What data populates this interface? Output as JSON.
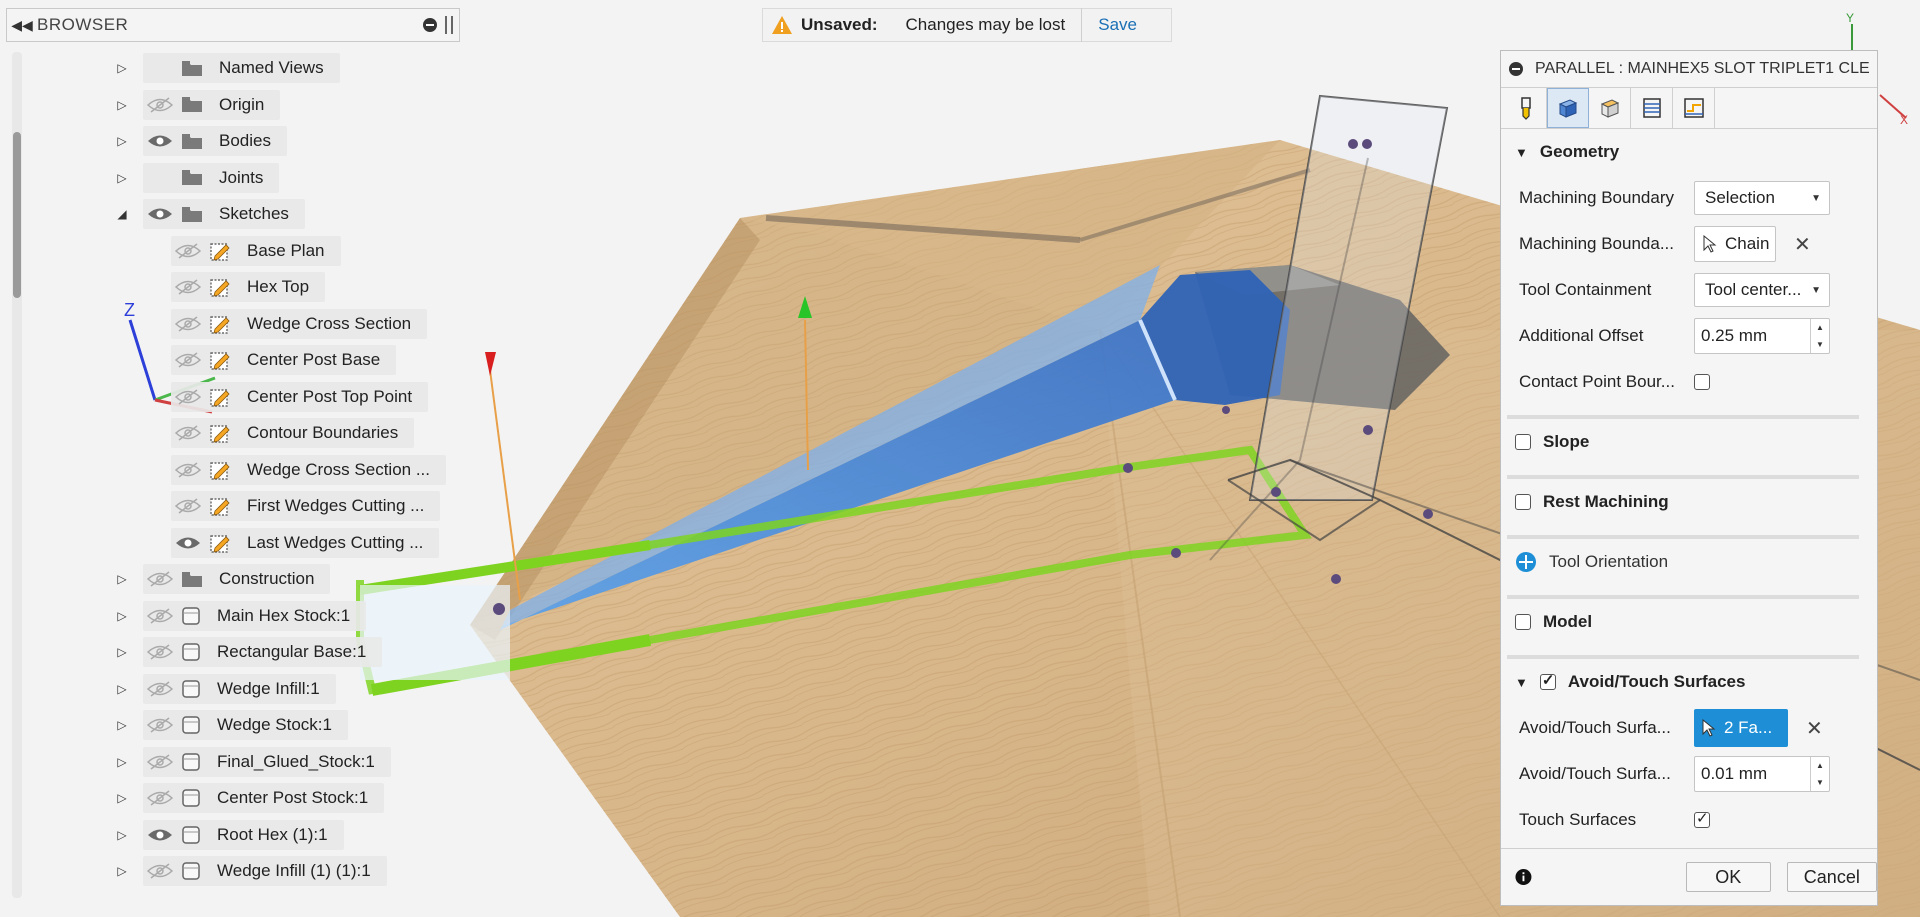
{
  "browser": {
    "title": "BROWSER",
    "items": [
      {
        "label": "Named Views",
        "level": 0,
        "expand": "collapsed",
        "eye": "none",
        "icon": "folder"
      },
      {
        "label": "Origin",
        "level": 0,
        "expand": "collapsed",
        "eye": "hidden",
        "icon": "folder"
      },
      {
        "label": "Bodies",
        "level": 0,
        "expand": "collapsed",
        "eye": "visible",
        "icon": "folder"
      },
      {
        "label": "Joints",
        "level": 0,
        "expand": "collapsed",
        "eye": "none",
        "icon": "folder"
      },
      {
        "label": "Sketches",
        "level": 0,
        "expand": "expanded",
        "eye": "visible",
        "icon": "folder"
      },
      {
        "label": "Base Plan",
        "level": 1,
        "expand": "none",
        "eye": "hidden",
        "icon": "sketch"
      },
      {
        "label": "Hex Top",
        "level": 1,
        "expand": "none",
        "eye": "hidden",
        "icon": "sketch"
      },
      {
        "label": "Wedge Cross Section",
        "level": 1,
        "expand": "none",
        "eye": "hidden",
        "icon": "sketch"
      },
      {
        "label": "Center Post Base",
        "level": 1,
        "expand": "none",
        "eye": "hidden",
        "icon": "sketch"
      },
      {
        "label": "Center Post Top Point",
        "level": 1,
        "expand": "none",
        "eye": "hidden",
        "icon": "sketch"
      },
      {
        "label": "Contour Boundaries",
        "level": 1,
        "expand": "none",
        "eye": "hidden",
        "icon": "sketch"
      },
      {
        "label": "Wedge Cross Section ...",
        "level": 1,
        "expand": "none",
        "eye": "hidden",
        "icon": "sketch"
      },
      {
        "label": "First Wedges Cutting ...",
        "level": 1,
        "expand": "none",
        "eye": "hidden",
        "icon": "sketch"
      },
      {
        "label": "Last Wedges Cutting ...",
        "level": 1,
        "expand": "none",
        "eye": "visible",
        "icon": "sketch"
      },
      {
        "label": "Construction",
        "level": 0,
        "expand": "collapsed",
        "eye": "hidden",
        "icon": "folder"
      },
      {
        "label": "Main Hex Stock:1",
        "level": 0,
        "expand": "collapsed",
        "eye": "hidden",
        "icon": "component"
      },
      {
        "label": "Rectangular Base:1",
        "level": 0,
        "expand": "collapsed",
        "eye": "hidden",
        "icon": "component"
      },
      {
        "label": "Wedge Infill:1",
        "level": 0,
        "expand": "collapsed",
        "eye": "hidden",
        "icon": "component"
      },
      {
        "label": "Wedge Stock:1",
        "level": 0,
        "expand": "collapsed",
        "eye": "hidden",
        "icon": "component"
      },
      {
        "label": "Final_Glued_Stock:1",
        "level": 0,
        "expand": "collapsed",
        "eye": "hidden",
        "icon": "component"
      },
      {
        "label": "Center Post Stock:1",
        "level": 0,
        "expand": "collapsed",
        "eye": "hidden",
        "icon": "component"
      },
      {
        "label": "Root Hex (1):1",
        "level": 0,
        "expand": "collapsed",
        "eye": "visible",
        "icon": "component"
      },
      {
        "label": "Wedge Infill (1) (1):1",
        "level": 0,
        "expand": "collapsed",
        "eye": "hidden",
        "icon": "component"
      }
    ]
  },
  "unsaved": {
    "status": "Unsaved:",
    "message": "Changes may be lost",
    "save": "Save"
  },
  "triad": {
    "z": "Z"
  },
  "dialog": {
    "title": "PARALLEL : MAINHEX5 SLOT TRIPLET1 CLE",
    "geometry": {
      "header": "Geometry",
      "machining_boundary_label": "Machining Boundary",
      "machining_boundary_value": "Selection",
      "machining_boundary_sel_label": "Machining Bounda...",
      "machining_boundary_sel_value": "Chain",
      "tool_containment_label": "Tool Containment",
      "tool_containment_value": "Tool center...",
      "additional_offset_label": "Additional Offset",
      "additional_offset_value": "0.25 mm",
      "contact_point_label": "Contact Point Bour..."
    },
    "slope": "Slope",
    "rest_machining": "Rest Machining",
    "tool_orientation": "Tool Orientation",
    "model": "Model",
    "avoid": {
      "header": "Avoid/Touch Surfaces",
      "surfaces_label": "Avoid/Touch Surfa...",
      "surfaces_value": "2 Fa...",
      "clearance_label": "Avoid/Touch Surfa...",
      "clearance_value": "0.01 mm",
      "touch_label": "Touch Surfaces"
    },
    "ok": "OK",
    "cancel": "Cancel"
  },
  "colors": {
    "accent": "#1e8fd6",
    "wood": "#d9b98e",
    "selection_blue": "#3a78d4",
    "boundary_green": "#7ed321"
  }
}
